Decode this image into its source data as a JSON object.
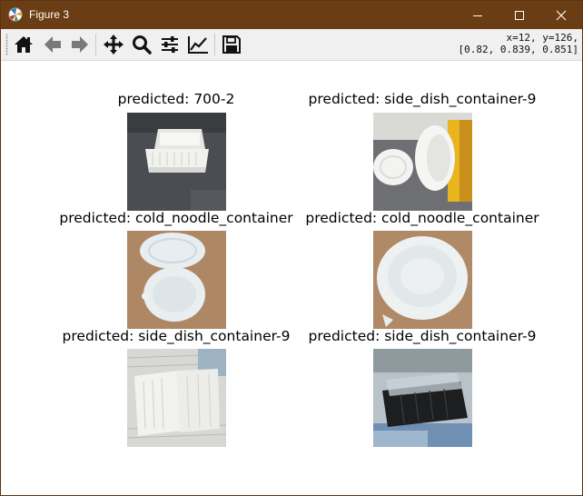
{
  "window": {
    "title": "Figure 3",
    "accent_color": "#6b3d14"
  },
  "toolbar": {
    "buttons": [
      {
        "name": "home",
        "icon": "home-icon"
      },
      {
        "name": "back",
        "icon": "arrow-left-icon"
      },
      {
        "name": "forward",
        "icon": "arrow-right-icon"
      },
      {
        "name": "pan",
        "icon": "move-icon"
      },
      {
        "name": "zoom",
        "icon": "magnifier-icon"
      },
      {
        "name": "configure-subplots",
        "icon": "sliders-icon"
      },
      {
        "name": "edit-axis",
        "icon": "line-chart-icon"
      },
      {
        "name": "save",
        "icon": "floppy-disk-icon"
      }
    ],
    "coords_line1": "x=12, y=126,",
    "coords_line2": "[0.82, 0.839, 0.851]"
  },
  "figure": {
    "panels": [
      {
        "caption": "predicted: 700-2",
        "image": "white plastic food container with lid on dark table"
      },
      {
        "caption": "predicted: side_dish_container-9",
        "image": "white bowl and lid on table with yellow bucket"
      },
      {
        "caption": "predicted: cold_noodle_container",
        "image": "white round container with open lid on wood"
      },
      {
        "caption": "predicted: cold_noodle_container",
        "image": "white round container top view on wood"
      },
      {
        "caption": "predicted: side_dish_container-9",
        "image": "white clamshell container on newspaper"
      },
      {
        "caption": "predicted: side_dish_container-9",
        "image": "black tray with clear lid on paper"
      }
    ]
  }
}
